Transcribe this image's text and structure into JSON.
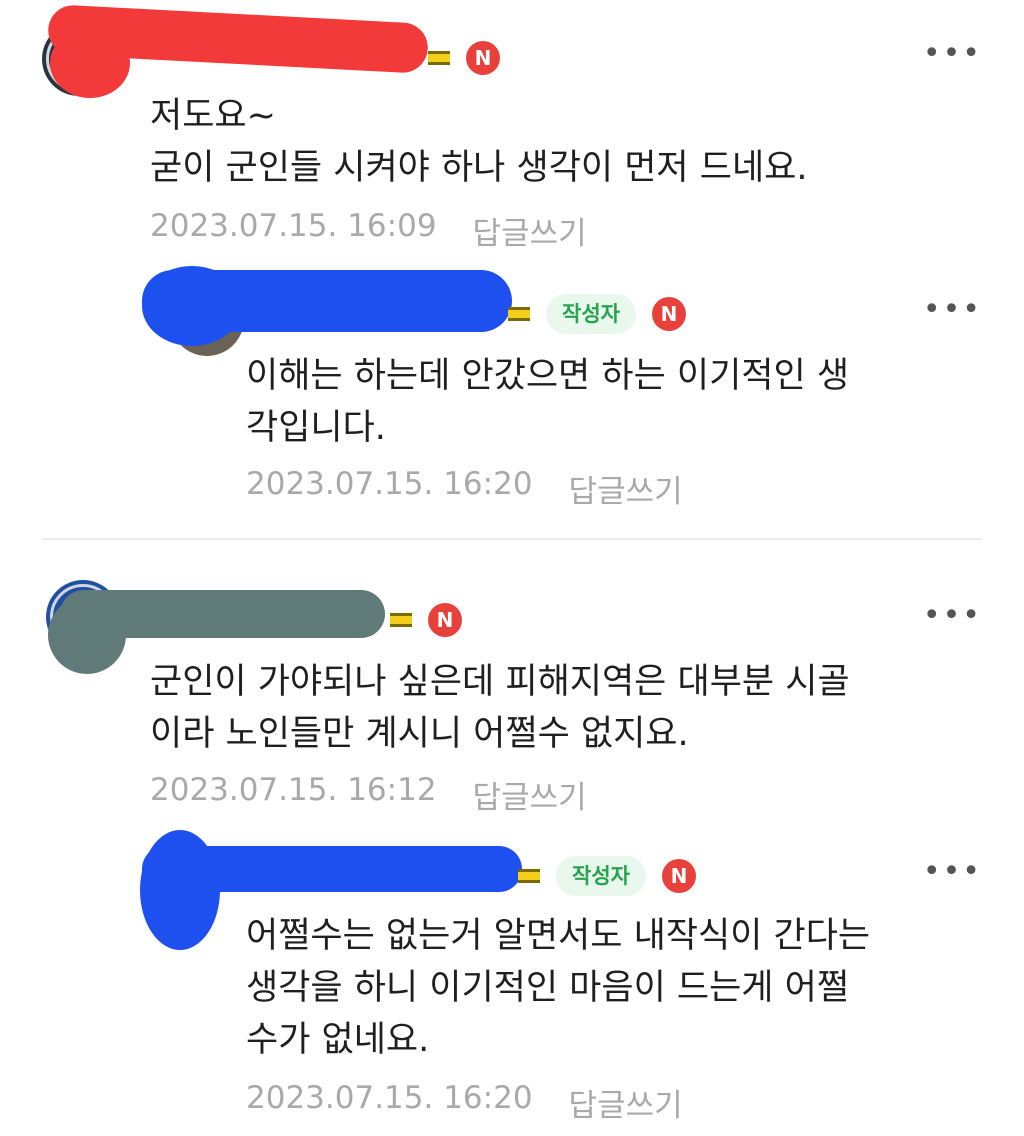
{
  "badges": {
    "author": "작성자",
    "new": "N"
  },
  "colors": {
    "redaction_red": "#f33a3a",
    "redaction_blue": "#1e4fef",
    "redaction_gray": "#5f7a78"
  },
  "comments": [
    {
      "name": "",
      "text": "저도요~\n굳이 군인들 시켜야 하나 생각이 먼저 드네요.",
      "date": "2023.07.15. 16:09",
      "reply_label": "답글쓰기",
      "more": "•••"
    },
    {
      "name": "",
      "text": "이해는 하는데 안갔으면 하는 이기적인 생\n각입니다.",
      "date": "2023.07.15. 16:20",
      "reply_label": "답글쓰기",
      "more": "•••"
    },
    {
      "name": "",
      "text": "군인이 가야되나 싶은데 피해지역은 대부분 시골\n이라 노인들만 계시니 어쩔수 없지요.",
      "date": "2023.07.15. 16:12",
      "reply_label": "답글쓰기",
      "more": "•••"
    },
    {
      "name": "",
      "text": "어쩔수는 없는거 알면서도 내작식이 간다는\n생각을 하니 이기적인 마음이 드는게 어쩔\n수가 없네요.",
      "date": "2023.07.15. 16:20",
      "reply_label": "답글쓰기",
      "more": "•••"
    }
  ]
}
